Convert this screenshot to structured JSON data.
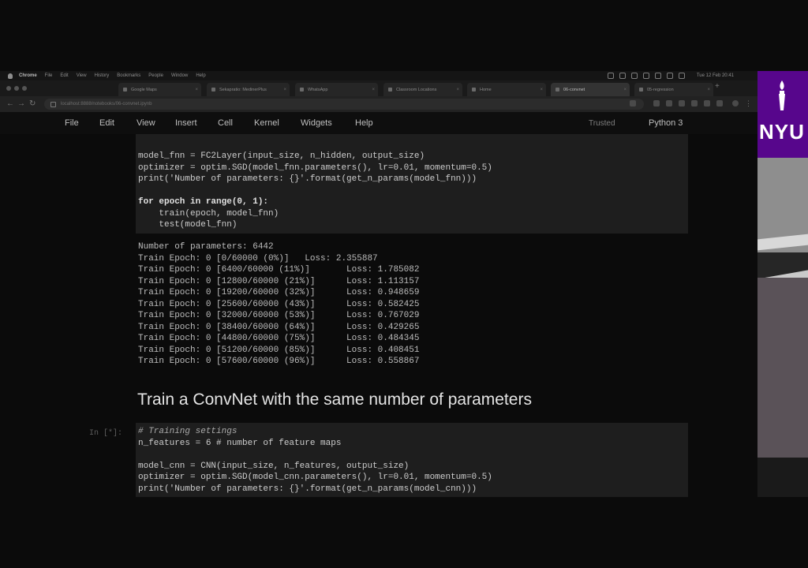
{
  "menubar": {
    "app": "Chrome",
    "items": [
      "File",
      "Edit",
      "View",
      "History",
      "Bookmarks",
      "People",
      "Window",
      "Help"
    ],
    "clock": "Tue 12 Feb  20:41"
  },
  "browser": {
    "tabs": [
      {
        "label": "Google Maps"
      },
      {
        "label": "Sekapratio: MedinerPlus"
      },
      {
        "label": "WhatsApp"
      },
      {
        "label": "Classroom Locations"
      },
      {
        "label": "Home"
      },
      {
        "label": "06-convnet"
      },
      {
        "label": "05-regression"
      }
    ],
    "url": "localhost:8888/notebooks/06-convnet.ipynb"
  },
  "jupyter_menu": {
    "items": [
      "File",
      "Edit",
      "View",
      "Insert",
      "Cell",
      "Kernel",
      "Widgets",
      "Help"
    ],
    "trusted": "Trusted",
    "kernel": "Python 3"
  },
  "cell1": {
    "lines": [
      "model_fnn = FC2Layer(input_size, n_hidden, output_size)",
      "optimizer = optim.SGD(model_fnn.parameters(), lr=0.01, momentum=0.5)",
      "print('Number of parameters: {}'.format(get_n_params(model_fnn)))",
      "",
      "for epoch in range(0, 1):",
      "    train(epoch, model_fnn)",
      "    test(model_fnn)"
    ]
  },
  "output1": {
    "lines": [
      "Number of parameters: 6442",
      "Train Epoch: 0 [0/60000 (0%)]\tLoss: 2.355887",
      "Train Epoch: 0 [6400/60000 (11%)]\tLoss: 1.785082",
      "Train Epoch: 0 [12800/60000 (21%)]\tLoss: 1.113157",
      "Train Epoch: 0 [19200/60000 (32%)]\tLoss: 0.948659",
      "Train Epoch: 0 [25600/60000 (43%)]\tLoss: 0.582425",
      "Train Epoch: 0 [32000/60000 (53%)]\tLoss: 0.767029",
      "Train Epoch: 0 [38400/60000 (64%)]\tLoss: 0.429265",
      "Train Epoch: 0 [44800/60000 (75%)]\tLoss: 0.484345",
      "Train Epoch: 0 [51200/60000 (85%)]\tLoss: 0.408451",
      "Train Epoch: 0 [57600/60000 (96%)]\tLoss: 0.558867"
    ]
  },
  "heading": "Train a ConvNet with the same number of parameters",
  "cell2": {
    "prompt": "In [*]:",
    "lines": [
      "# Training settings",
      "n_features = 6 # number of feature maps",
      "",
      "model_cnn = CNN(input_size, n_features, output_size)",
      "optimizer = optim.SGD(model_cnn.parameters(), lr=0.01, momentum=0.5)",
      "print('Number of parameters: {}'.format(get_n_params(model_cnn)))"
    ]
  },
  "sidevideo": {
    "logo_text": "NYU",
    "brand_color": "#57068c"
  }
}
